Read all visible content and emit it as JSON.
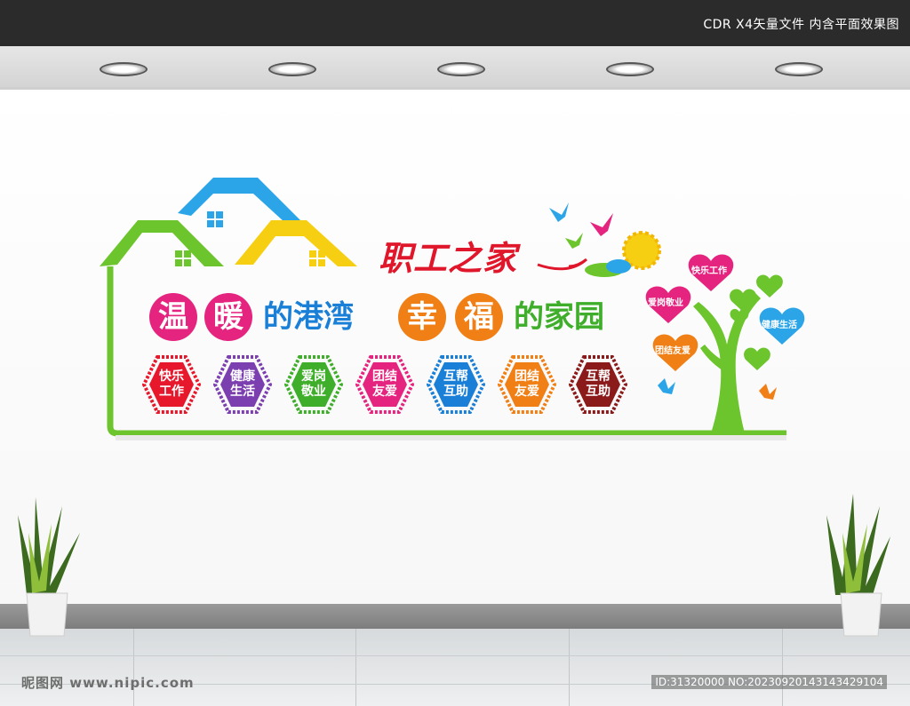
{
  "header": {
    "caption": "CDR X4矢量文件  内含平面效果图"
  },
  "board": {
    "title": "职工之家",
    "slogan": {
      "c1": "温",
      "c2": "暖",
      "p1": "的港湾",
      "c3": "幸",
      "c4": "福",
      "p2": "的家园"
    },
    "badges": [
      {
        "text": "快乐工作",
        "color": "#e8182c"
      },
      {
        "text": "健康生活",
        "color": "#7b3fb0"
      },
      {
        "text": "爱岗敬业",
        "color": "#3fae2a"
      },
      {
        "text": "团结友爱",
        "color": "#e5247f"
      },
      {
        "text": "互帮互助",
        "color": "#1a7fd6"
      },
      {
        "text": "团结友爱",
        "color": "#f07f16"
      },
      {
        "text": "互帮互助",
        "color": "#8b1b1b"
      }
    ],
    "tree_hearts": [
      "快乐工作",
      "爱岗敬业",
      "健康生活",
      "团结友爱"
    ],
    "colors": {
      "green": "#6cc52c",
      "blue": "#2ba5e8",
      "yellow": "#f7cf12",
      "red": "#e0162b",
      "pink": "#e5247f",
      "orange": "#f07f16"
    }
  },
  "watermark": {
    "left": "昵图网 www.nipic.com",
    "right": "ID:31320000 NO:20230920143143429104"
  }
}
